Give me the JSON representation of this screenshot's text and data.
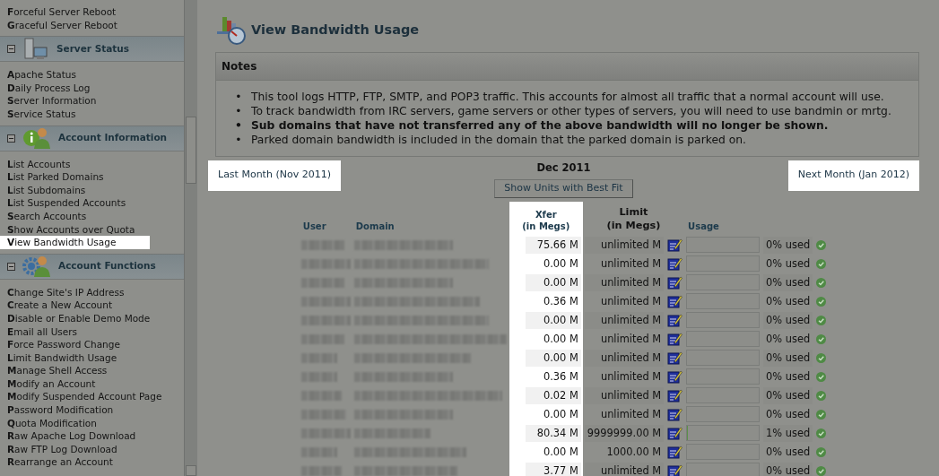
{
  "sidebar": {
    "sections": [
      {
        "items": [
          {
            "label": "**F**orceful Server Reboot",
            "highlighted": false
          },
          {
            "label": "**G**raceful Server Reboot",
            "highlighted": false
          }
        ]
      },
      {
        "title": "Server Status",
        "expanded": true,
        "items": [
          {
            "label": "**A**pache Status",
            "highlighted": false
          },
          {
            "label": "**D**aily Process Log",
            "highlighted": false
          },
          {
            "label": "**S**erver Information",
            "highlighted": false
          },
          {
            "label": "**S**ervice Status",
            "highlighted": false
          }
        ]
      },
      {
        "title": "Account Information",
        "expanded": true,
        "items": [
          {
            "label": "**L**ist Accounts",
            "highlighted": false
          },
          {
            "label": "**L**ist Parked Domains",
            "highlighted": false
          },
          {
            "label": "**L**ist Subdomains",
            "highlighted": false
          },
          {
            "label": "**L**ist Suspended Accounts",
            "highlighted": false
          },
          {
            "label": "**S**earch Accounts",
            "highlighted": false
          },
          {
            "label": "**S**how Accounts over Quota",
            "highlighted": false
          },
          {
            "label": "**V**iew Bandwidth Usage",
            "highlighted": true
          }
        ]
      },
      {
        "title": "Account Functions",
        "expanded": true,
        "items": [
          {
            "label": "**C**hange Site's IP Address",
            "highlighted": false
          },
          {
            "label": "**C**reate a New Account",
            "highlighted": false
          },
          {
            "label": "**D**isable or Enable Demo Mode",
            "highlighted": false
          },
          {
            "label": "**E**mail all Users",
            "highlighted": false
          },
          {
            "label": "**F**orce Password Change",
            "highlighted": false
          },
          {
            "label": "**L**imit Bandwidth Usage",
            "highlighted": false
          },
          {
            "label": "**M**anage Shell Access",
            "highlighted": false
          },
          {
            "label": "**M**odify an Account",
            "highlighted": false
          },
          {
            "label": "**M**odify Suspended Account Page",
            "highlighted": false
          },
          {
            "label": "**P**assword Modification",
            "highlighted": false
          },
          {
            "label": "**Q**uota Modification",
            "highlighted": false
          },
          {
            "label": "**R**aw Apache Log Download",
            "highlighted": false
          },
          {
            "label": "**R**aw FTP Log Download",
            "highlighted": false
          },
          {
            "label": "**R**earrange an Account",
            "highlighted": false
          }
        ]
      }
    ]
  },
  "main": {
    "title": "View Bandwidth Usage",
    "notes": {
      "title": "Notes",
      "marker": "•",
      "items": [
        {
          "text": "This tool logs HTTP, FTP, SMTP, and POP3 traffic. This accounts for almost all traffic that a normal account will use.",
          "bold": false
        },
        {
          "text": "To track bandwidth from IRC servers, game servers or other types of servers, you will need to use bandmin or mrtg.",
          "bold": false
        },
        {
          "text": "Sub domains that have not transferred any of the above bandwidth will no longer be shown.",
          "bold": true
        },
        {
          "text": "Parked domain bandwidth is included in the domain that the parked domain is parked on.",
          "bold": false
        }
      ]
    },
    "previous_month": {
      "label": "Last Month (Nov 2011)",
      "highlighted": true
    },
    "current_month": "Dec 2011",
    "next_month": {
      "label": "Next Month (Jan 2012)",
      "highlighted": true
    },
    "units_button": "Show Units with Best Fit",
    "table": {
      "columns": [
        {
          "label": "User",
          "sortable": true,
          "highlighted": false
        },
        {
          "label": "Domain",
          "sortable": true,
          "highlighted": false
        },
        {
          "label": "Xfer\n(in Megs)",
          "sortable": true,
          "highlighted": true
        },
        {
          "label": "Limit\n(in Megs)",
          "sortable": false,
          "highlighted": false
        },
        {
          "label": "Usage",
          "sortable": true,
          "highlighted": false
        }
      ],
      "rows": [
        {
          "xfer": "75.66 M",
          "limit": "unlimited M",
          "level": 0,
          "usage": "0% used"
        },
        {
          "xfer": "0.00 M",
          "limit": "unlimited M",
          "level": 0,
          "usage": "0% used"
        },
        {
          "xfer": "0.00 M",
          "limit": "unlimited M",
          "level": 0,
          "usage": "0% used"
        },
        {
          "xfer": "0.36 M",
          "limit": "unlimited M",
          "level": 0,
          "usage": "0% used"
        },
        {
          "xfer": "0.00 M",
          "limit": "unlimited M",
          "level": 0,
          "usage": "0% used"
        },
        {
          "xfer": "0.00 M",
          "limit": "unlimited M",
          "level": 0,
          "usage": "0% used"
        },
        {
          "xfer": "0.00 M",
          "limit": "unlimited M",
          "level": 0,
          "usage": "0% used"
        },
        {
          "xfer": "0.36 M",
          "limit": "unlimited M",
          "level": 0,
          "usage": "0% used"
        },
        {
          "xfer": "0.02 M",
          "limit": "unlimited M",
          "level": 0,
          "usage": "0% used"
        },
        {
          "xfer": "0.00 M",
          "limit": "unlimited M",
          "level": 0,
          "usage": "0% used"
        },
        {
          "xfer": "80.34 M",
          "limit": "9999999.00 M",
          "level": 0.01,
          "usage": "1% used"
        },
        {
          "xfer": "0.00 M",
          "limit": "1000.00 M",
          "level": 0,
          "usage": "0% used"
        },
        {
          "xfer": "3.77 M",
          "limit": "unlimited M",
          "level": 0,
          "usage": "0% used"
        }
      ]
    }
  }
}
